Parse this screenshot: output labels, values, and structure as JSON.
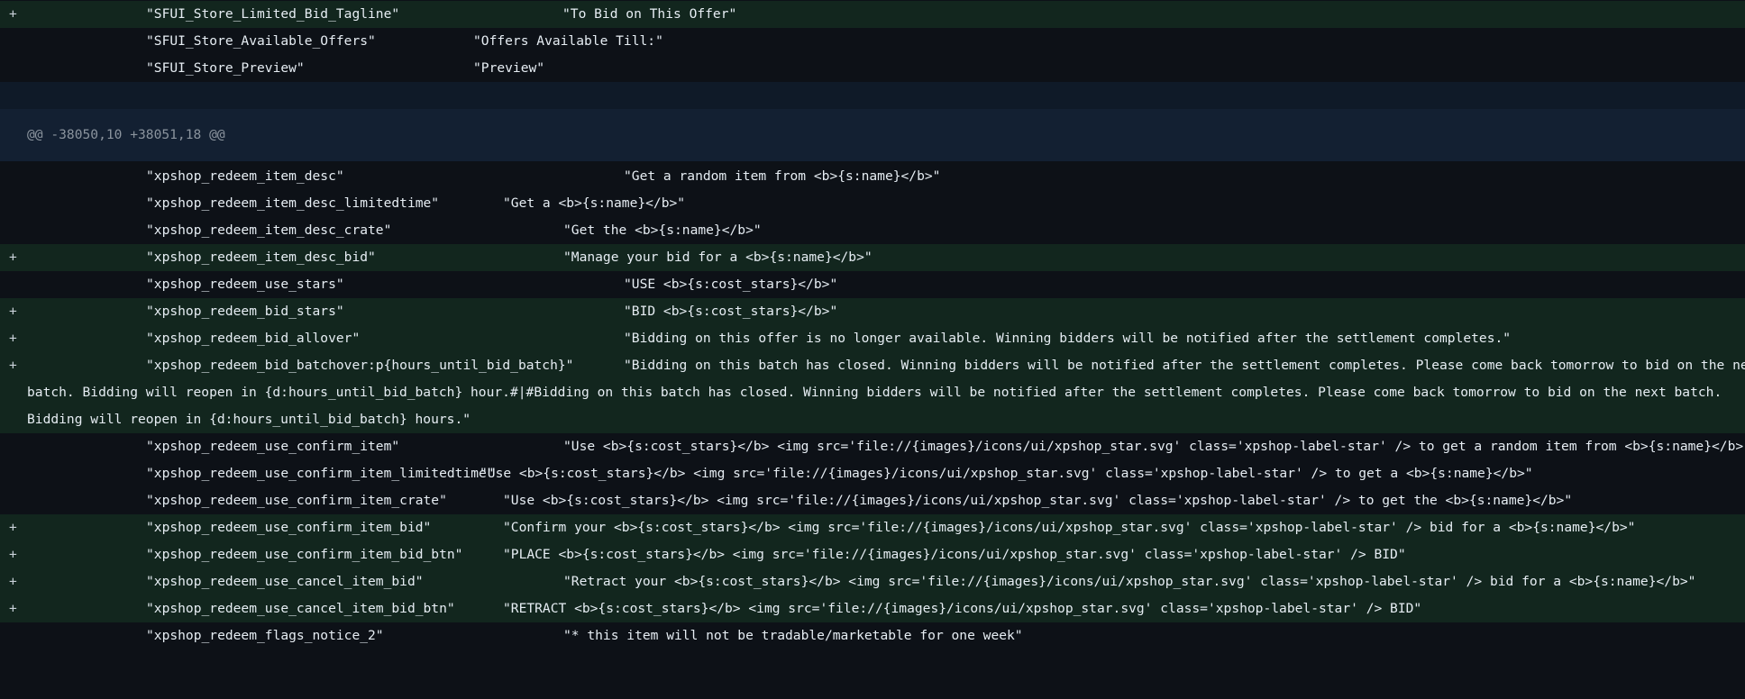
{
  "diff": {
    "hunk_header": "@@ -38050,10 +38051,18 @@",
    "rows": [
      {
        "type": "added",
        "marker": "+",
        "key": "\"SFUI_Store_Limited_Bid_Tagline\"",
        "value": "\"To Bid on This Offer\""
      },
      {
        "type": "context",
        "marker": "",
        "key": "\"SFUI_Store_Available_Offers\"",
        "value": "\"Offers Available Till:\""
      },
      {
        "type": "context",
        "marker": "",
        "key": "\"SFUI_Store_Preview\"",
        "value": "\"Preview\""
      },
      {
        "type": "context",
        "marker": "",
        "key": "\"xpshop_redeem_item_desc\"",
        "value": "\"Get a random item from <b>{s:name}</b>\""
      },
      {
        "type": "context",
        "marker": "",
        "key": "\"xpshop_redeem_item_desc_limitedtime\"",
        "value": "\"Get a <b>{s:name}</b>\""
      },
      {
        "type": "context",
        "marker": "",
        "key": "\"xpshop_redeem_item_desc_crate\"",
        "value": "\"Get the <b>{s:name}</b>\""
      },
      {
        "type": "added",
        "marker": "+",
        "key": "\"xpshop_redeem_item_desc_bid\"",
        "value": "\"Manage your bid for a <b>{s:name}</b>\""
      },
      {
        "type": "context",
        "marker": "",
        "key": "\"xpshop_redeem_use_stars\"",
        "value": "\"USE <b>{s:cost_stars}</b>\""
      },
      {
        "type": "added",
        "marker": "+",
        "key": "\"xpshop_redeem_bid_stars\"",
        "value": "\"BID <b>{s:cost_stars}</b>\""
      },
      {
        "type": "added",
        "marker": "+",
        "key": "\"xpshop_redeem_bid_allover\"",
        "value": "\"Bidding on this offer is no longer available. Winning bidders will be notified after the settlement completes.\""
      },
      {
        "type": "added",
        "marker": "+",
        "key": "\"xpshop_redeem_bid_batchover:p{hours_until_bid_batch}\"",
        "value": "\"Bidding on this batch has closed. Winning bidders will be notified after the settlement completes. Please come back tomorrow to bid on the next",
        "continuation": "batch. Bidding will reopen in {d:hours_until_bid_batch} hour.#|#Bidding on this batch has closed. Winning bidders will be notified after the settlement completes. Please come back tomorrow to bid on the next batch. Bidding will reopen in {d:hours_until_bid_batch} hours.\""
      },
      {
        "type": "context",
        "marker": "",
        "key": "\"xpshop_redeem_use_confirm_item\"",
        "value": "\"Use <b>{s:cost_stars}</b> <img src='file://{images}/icons/ui/xpshop_star.svg' class='xpshop-label-star' /> to get a random item from <b>{s:name}</b>\""
      },
      {
        "type": "context",
        "marker": "",
        "key": "\"xpshop_redeem_use_confirm_item_limitedtime\"",
        "value": "\"Use <b>{s:cost_stars}</b> <img src='file://{images}/icons/ui/xpshop_star.svg' class='xpshop-label-star' /> to get a <b>{s:name}</b>\""
      },
      {
        "type": "context",
        "marker": "",
        "key": "\"xpshop_redeem_use_confirm_item_crate\"",
        "value": "\"Use <b>{s:cost_stars}</b> <img src='file://{images}/icons/ui/xpshop_star.svg' class='xpshop-label-star' /> to get the <b>{s:name}</b>\""
      },
      {
        "type": "added",
        "marker": "+",
        "key": "\"xpshop_redeem_use_confirm_item_bid\"",
        "value": "\"Confirm your <b>{s:cost_stars}</b> <img src='file://{images}/icons/ui/xpshop_star.svg' class='xpshop-label-star' /> bid for a <b>{s:name}</b>\""
      },
      {
        "type": "added",
        "marker": "+",
        "key": "\"xpshop_redeem_use_confirm_item_bid_btn\"",
        "value": "\"PLACE <b>{s:cost_stars}</b> <img src='file://{images}/icons/ui/xpshop_star.svg' class='xpshop-label-star' /> BID\""
      },
      {
        "type": "added",
        "marker": "+",
        "key": "\"xpshop_redeem_use_cancel_item_bid\"",
        "value": "\"Retract your <b>{s:cost_stars}</b> <img src='file://{images}/icons/ui/xpshop_star.svg' class='xpshop-label-star' /> bid for a <b>{s:name}</b>\""
      },
      {
        "type": "added",
        "marker": "+",
        "key": "\"xpshop_redeem_use_cancel_item_bid_btn\"",
        "value": "\"RETRACT <b>{s:cost_stars}</b> <img src='file://{images}/icons/ui/xpshop_star.svg' class='xpshop-label-star' /> BID\""
      },
      {
        "type": "context",
        "marker": "",
        "key": "\"xpshop_redeem_flags_notice_2\"",
        "value": "\"* this item will not be tradable/marketable for one week\""
      }
    ]
  }
}
